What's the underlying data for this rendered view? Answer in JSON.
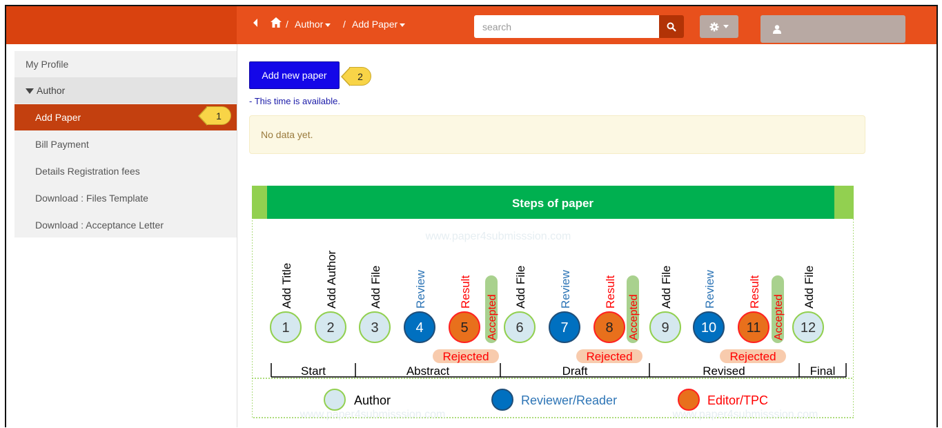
{
  "topbar": {
    "breadcrumb": [
      "Author",
      "Add Paper"
    ],
    "search_placeholder": "search",
    "icons": [
      "chevron-left-icon",
      "home-icon",
      "search-icon",
      "gear-icon",
      "user-icon"
    ]
  },
  "sidebar": {
    "items": [
      {
        "label": "My Profile"
      },
      {
        "label": "Author"
      },
      {
        "label": "Add Paper"
      },
      {
        "label": "Bill Payment"
      },
      {
        "label": "Details Registration fees"
      },
      {
        "label": "Download : Files Template"
      },
      {
        "label": "Download : Acceptance Letter"
      }
    ],
    "active": "Add Paper"
  },
  "callouts": [
    "1",
    "2"
  ],
  "main": {
    "add_button_label": "Add new paper",
    "availability_text": "- This time is available.",
    "alert_text": "No data yet."
  },
  "steps": {
    "title": "Steps of paper",
    "watermark": "www.paper4submisssion.com",
    "nodes": [
      {
        "n": "1",
        "label": "Add Title",
        "role": "author"
      },
      {
        "n": "2",
        "label": "Add Author",
        "role": "author"
      },
      {
        "n": "3",
        "label": "Add File",
        "role": "author"
      },
      {
        "n": "4",
        "label": "Review",
        "role": "reviewer"
      },
      {
        "n": "5",
        "label": "Result",
        "role": "editor"
      },
      {
        "n": "6",
        "label": "Add File",
        "role": "author"
      },
      {
        "n": "7",
        "label": "Review",
        "role": "reviewer"
      },
      {
        "n": "8",
        "label": "Result",
        "role": "editor"
      },
      {
        "n": "9",
        "label": "Add File",
        "role": "author"
      },
      {
        "n": "10",
        "label": "Review",
        "role": "reviewer"
      },
      {
        "n": "11",
        "label": "Result",
        "role": "editor"
      },
      {
        "n": "12",
        "label": "Add File",
        "role": "author"
      }
    ],
    "accepted_label": "Accepted",
    "rejected_label": "Rejected",
    "phases": [
      "Start",
      "Abstract",
      "Draft",
      "Revised",
      "Final"
    ],
    "legend": [
      "Author",
      "Reviewer/Reader",
      "Editor/TPC"
    ],
    "colors": {
      "header_green": "#00b050",
      "header_side": "#92d050",
      "author_fill": "#d5e8ef",
      "author_stroke": "#92d050",
      "reviewer_fill": "#0070c0",
      "editor_fill": "#e8701c",
      "editor_stroke": "#ff2020",
      "accepted_fill": "#a9d18e",
      "rejected_fill": "#f8cbad",
      "review_text": "#2e75b6",
      "result_text": "#ff0000"
    }
  }
}
